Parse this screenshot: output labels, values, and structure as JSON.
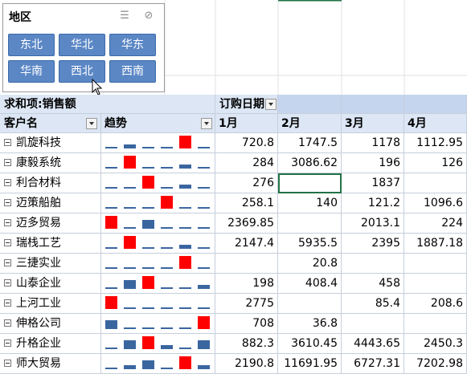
{
  "slicer": {
    "title": "地区",
    "multiselect_icon": "multiselect-icon",
    "clear_filter_icon": "clear-filter-icon",
    "buttons": [
      "东北",
      "华北",
      "华东",
      "华南",
      "西北",
      "西南"
    ]
  },
  "pivot": {
    "value_header": "求和项:销售额",
    "column_field": "订购日期",
    "row_field": "客户名",
    "trend_header": "趋势",
    "months": [
      "1月",
      "2月",
      "3月",
      "4月"
    ],
    "rows": [
      {
        "name": "凯旋科技",
        "v": [
          "720.8",
          "1747.5",
          "1178",
          "1112.95"
        ],
        "spark": [
          0,
          1,
          0,
          0,
          3,
          0
        ]
      },
      {
        "name": "康毅系统",
        "v": [
          "284",
          "3086.62",
          "196",
          "126"
        ],
        "spark": [
          0,
          3,
          0,
          0,
          1,
          0
        ]
      },
      {
        "name": "利合材料",
        "v": [
          "276",
          "",
          "1837",
          ""
        ],
        "spark": [
          0,
          0,
          3,
          0,
          1,
          0
        ]
      },
      {
        "name": "迈策船舶",
        "v": [
          "258.1",
          "140",
          "121.2",
          "1096.6"
        ],
        "spark": [
          0,
          0,
          0,
          3,
          0,
          0
        ]
      },
      {
        "name": "迈多贸易",
        "v": [
          "2369.85",
          "",
          "2013.1",
          "224"
        ],
        "spark": [
          3,
          0,
          2,
          0,
          0,
          0
        ]
      },
      {
        "name": "瑞栈工艺",
        "v": [
          "2147.4",
          "5935.5",
          "2395",
          "1887.18"
        ],
        "spark": [
          0,
          3,
          0,
          0,
          1,
          0
        ]
      },
      {
        "name": "三捷实业",
        "v": [
          "",
          "20.8",
          "",
          ""
        ],
        "spark": [
          0,
          0,
          0,
          0,
          3,
          0
        ]
      },
      {
        "name": "山泰企业",
        "v": [
          "198",
          "408.4",
          "458",
          ""
        ],
        "spark": [
          0,
          2,
          3,
          0,
          0,
          1
        ]
      },
      {
        "name": "上河工业",
        "v": [
          "2775",
          "",
          "85.4",
          "208.6"
        ],
        "spark": [
          3,
          0,
          0,
          0,
          0,
          0
        ]
      },
      {
        "name": "伸格公司",
        "v": [
          "708",
          "36.8",
          "",
          ""
        ],
        "spark": [
          2,
          0,
          0,
          0,
          0,
          3
        ]
      },
      {
        "name": "升格企业",
        "v": [
          "882.3",
          "3610.45",
          "4443.65",
          "2450.3"
        ],
        "spark": [
          0,
          2,
          3,
          1,
          0,
          2
        ]
      },
      {
        "name": "师大贸易",
        "v": [
          "2190.8",
          "11691.95",
          "6727.31",
          "7202.98"
        ],
        "spark": [
          0,
          1,
          2,
          0,
          3,
          1
        ]
      }
    ]
  },
  "colors": {
    "slicer_button": "#5b87c5",
    "header": "#dce6f4",
    "spark_high": "#ff0000",
    "spark": "#3a66a0",
    "selection": "#217346"
  }
}
